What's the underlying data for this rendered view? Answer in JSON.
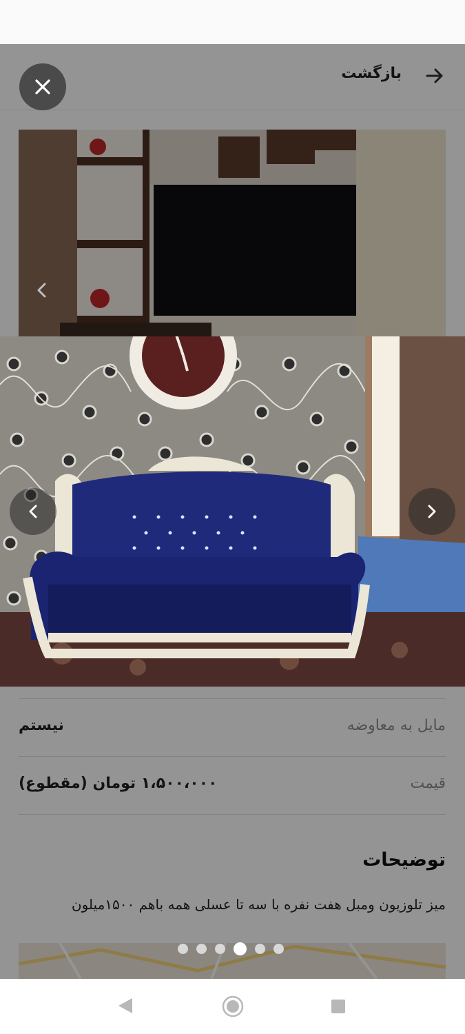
{
  "header": {
    "back_label": "بازگشت"
  },
  "details": [
    {
      "label": "مایل به معاوضه",
      "value": "نیستم"
    },
    {
      "label": "قیمت",
      "value": "۱،۵۰۰،۰۰۰ تومان (مقطوع)"
    }
  ],
  "description": {
    "title": "توضیحات",
    "text": "میز تلوزیون ومبل هفت نفره با سه تا عسلی همه باهم ۱۵۰۰میلون"
  },
  "viewer": {
    "photo_count": 6,
    "active_index": 3,
    "overlay_color": "#000000"
  },
  "colors": {
    "sofa_blue": "#1a2470",
    "wall_grey": "#8d8a84",
    "frame_ivory": "#ece6d6"
  }
}
